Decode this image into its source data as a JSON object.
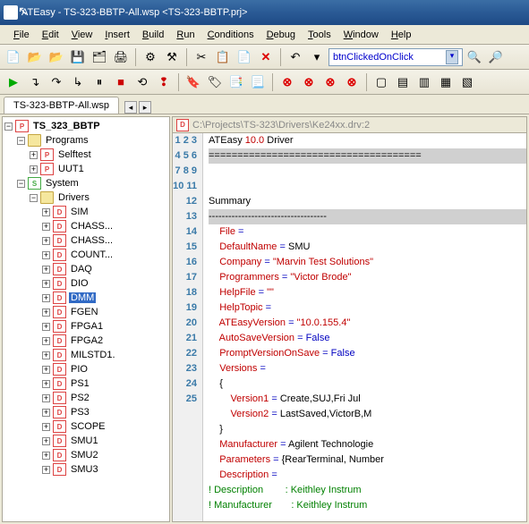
{
  "title": "ATEasy - TS-323-BBTP-All.wsp <TS-323-BBTP.prj>",
  "menu": {
    "file": "File",
    "edit": "Edit",
    "view": "View",
    "insert": "Insert",
    "build": "Build",
    "run": "Run",
    "conditions": "Conditions",
    "debug": "Debug",
    "tools": "Tools",
    "window": "Window",
    "help": "Help"
  },
  "combo_value": "btnClickedOnClick",
  "tab1": "TS-323-BBTP-All.wsp",
  "tree": {
    "root": "TS_323_BBTP",
    "programs": "Programs",
    "selftest": "Selftest",
    "uut1": "UUT1",
    "system": "System",
    "drivers": "Drivers",
    "items": [
      "SIM",
      "CHASS...",
      "CHASS...",
      "COUNT...",
      "DAQ",
      "DIO",
      "DMM",
      "FGEN",
      "FPGA1",
      "FPGA2",
      "MILSTD1.",
      "PIO",
      "PS1",
      "PS2",
      "PS3",
      "SCOPE",
      "SMU1",
      "SMU2",
      "SMU3"
    ]
  },
  "editor_path": "C:\\Projects\\TS-323\\Drivers\\Ke24xx.drv:2",
  "code": {
    "l1a": "ATEasy ",
    "l1b": "10.0",
    "l1c": " Driver",
    "l2": "=====================================",
    "l5": "Summary",
    "l6": "------------------------------------",
    "l7a": "    File ",
    "eq": "=",
    "l8a": "    DefaultName ",
    "l8c": " SMU",
    "l9a": "    Company ",
    "l9c": " \"Marvin Test Solutions\"",
    "l10a": "    Programmers ",
    "l10c": " \"Victor Brode\"",
    "l11a": "    HelpFile ",
    "l11c": " \"\"",
    "l12a": "    HelpTopic ",
    "l12c": " ",
    "l13a": "    ATEasyVersion ",
    "l13c": " \"10.0.155.4\"",
    "l14a": "    AutoSaveVersion ",
    "l14c": " False",
    "l15a": "    PromptVersionOnSave ",
    "l15c": " False",
    "l16a": "    Versions ",
    "l17": "    {",
    "l18a": "        Version1 ",
    "l18c": " Create,SUJ,Fri Jul ",
    "l19a": "        Version2 ",
    "l19c": " LastSaved,VictorB,M",
    "l20": "    }",
    "l21a": "    Manufacturer ",
    "l21c": " Agilent Technologie",
    "l22a": "    Parameters ",
    "l22c": " {RearTerminal, Number",
    "l23a": "    Description ",
    "l24": "! Description        : Keithley Instrum",
    "l25": "! Manufacturer       : Keithley Instrum"
  }
}
